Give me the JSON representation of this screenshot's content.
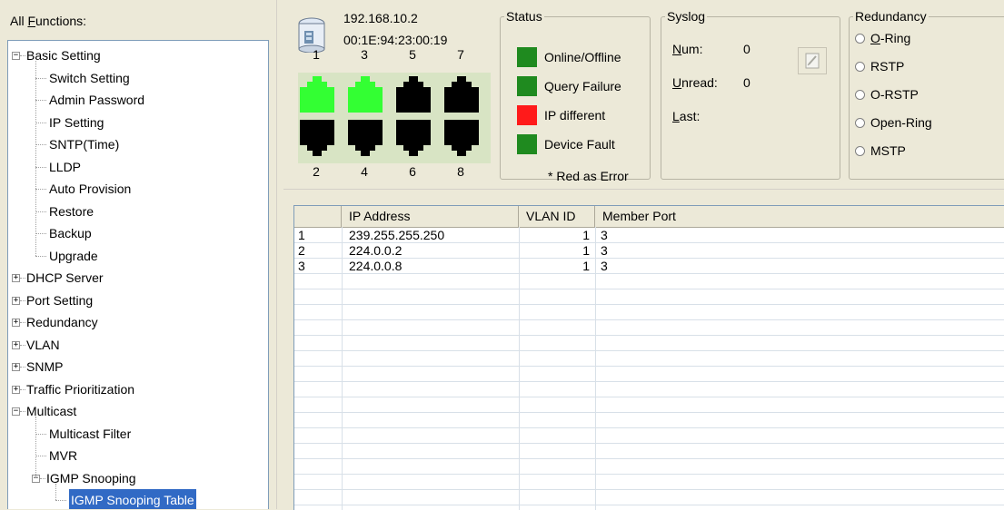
{
  "left": {
    "title_prefix": "All ",
    "title_accel": "F",
    "title_rest": "unctions:",
    "tree": [
      {
        "label": "Basic Setting",
        "level": 0,
        "expander": "-"
      },
      {
        "label": "Switch Setting",
        "level": 1
      },
      {
        "label": "Admin Password",
        "level": 1
      },
      {
        "label": "IP Setting",
        "level": 1
      },
      {
        "label": "SNTP(Time)",
        "level": 1
      },
      {
        "label": "LLDP",
        "level": 1
      },
      {
        "label": "Auto Provision",
        "level": 1
      },
      {
        "label": "Restore",
        "level": 1
      },
      {
        "label": "Backup",
        "level": 1
      },
      {
        "label": "Upgrade",
        "level": 1
      },
      {
        "label": "DHCP Server",
        "level": 0,
        "expander": "+"
      },
      {
        "label": "Port Setting",
        "level": 0,
        "expander": "+"
      },
      {
        "label": "Redundancy",
        "level": 0,
        "expander": "+"
      },
      {
        "label": "VLAN",
        "level": 0,
        "expander": "+"
      },
      {
        "label": "SNMP",
        "level": 0,
        "expander": "+"
      },
      {
        "label": "Traffic Prioritization",
        "level": 0,
        "expander": "+"
      },
      {
        "label": "Multicast",
        "level": 0,
        "expander": "-"
      },
      {
        "label": "Multicast Filter",
        "level": 1
      },
      {
        "label": "MVR",
        "level": 1
      },
      {
        "label": "IGMP Snooping",
        "level": 1,
        "expander": "-"
      },
      {
        "label": "IGMP Snooping Table",
        "level": 2,
        "selected": true
      }
    ]
  },
  "device": {
    "ip": "192.168.10.2",
    "mac": "00:1E:94:23:00:19",
    "ports_top_numbers": [
      "1",
      "3",
      "5",
      "7"
    ],
    "ports_bottom_numbers": [
      "2",
      "4",
      "6",
      "8"
    ],
    "ports_top_states": [
      "link-up",
      "link-up",
      "link-down",
      "link-down"
    ],
    "ports_bottom_states": [
      "link-down",
      "link-down",
      "link-down",
      "link-down"
    ],
    "link_up_color": "#33ff33",
    "link_down_color": "#000000"
  },
  "status": {
    "title": "Status",
    "items": [
      {
        "label": "Online/Offline",
        "color": "#1f8a1f"
      },
      {
        "label": "Query Failure",
        "color": "#1f8a1f"
      },
      {
        "label": "IP different",
        "color": "#ff1a1a"
      },
      {
        "label": "Device Fault",
        "color": "#1f8a1f"
      }
    ],
    "note": "* Red as Error"
  },
  "syslog": {
    "title": "Syslog",
    "num_accel": "N",
    "num_rest": "um:",
    "num_value": "0",
    "unread_accel": "U",
    "unread_rest": "nread:",
    "unread_value": "0",
    "last_accel": "L",
    "last_rest": "ast:",
    "last_value": "",
    "button_icon": "edit-icon"
  },
  "redundancy": {
    "title": "Redundancy",
    "options": [
      {
        "accel": "O",
        "rest": "-Ring"
      },
      {
        "accel": "",
        "rest": "RSTP"
      },
      {
        "accel": "",
        "rest": "O-RSTP"
      },
      {
        "accel": "",
        "rest": "Open-Ring"
      },
      {
        "accel": "",
        "rest": "MSTP"
      }
    ]
  },
  "table": {
    "columns": [
      "",
      "IP Address",
      "VLAN ID",
      "Member Port"
    ],
    "rows": [
      [
        "1",
        "239.255.255.250",
        "1",
        "3"
      ],
      [
        "2",
        "224.0.0.2",
        "1",
        "3"
      ],
      [
        "3",
        "224.0.0.8",
        "1",
        "3"
      ]
    ]
  }
}
